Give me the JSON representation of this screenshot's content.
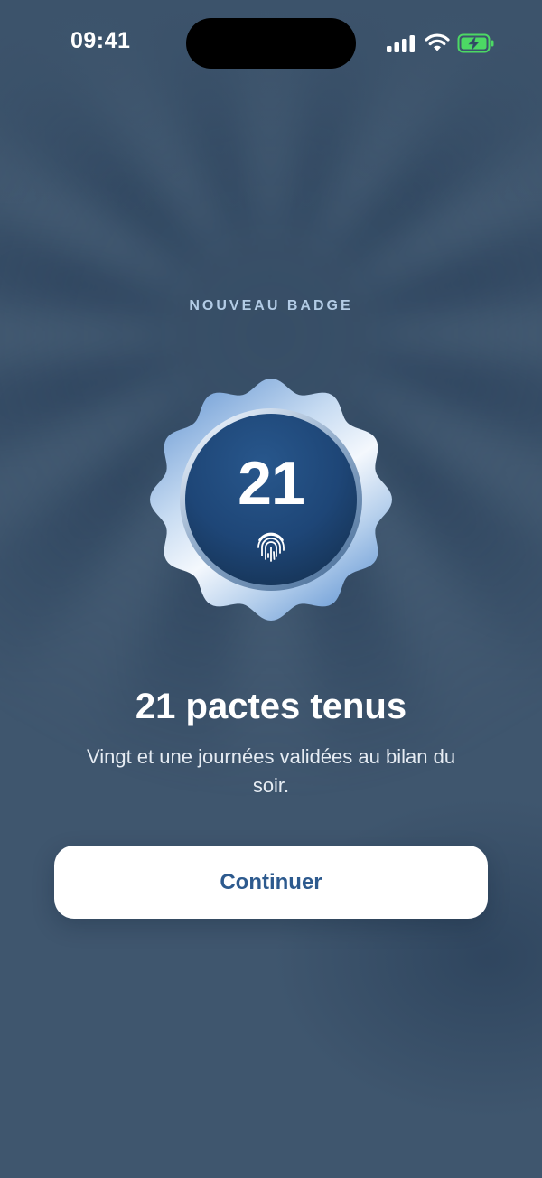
{
  "status_bar": {
    "time": "09:41"
  },
  "badge": {
    "eyebrow": "NOUVEAU BADGE",
    "number": "21",
    "icon": "fingerprint-icon",
    "title": "21 pactes tenus",
    "description": "Vingt et une journées validées au bilan du soir."
  },
  "actions": {
    "continue_label": "Continuer"
  },
  "colors": {
    "background": "#3f566e",
    "badge_inner": "#1f4c7e",
    "button_text": "#2d5a8e",
    "battery_green": "#4cd964"
  }
}
